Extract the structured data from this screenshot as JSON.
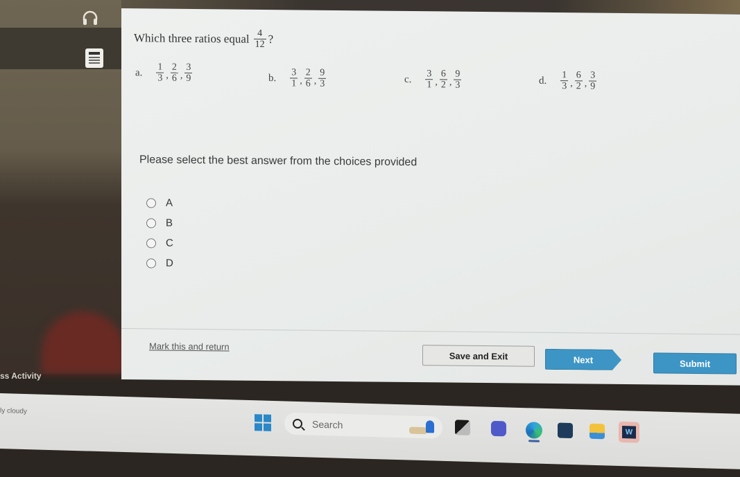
{
  "question": {
    "prompt": "Which three ratios equal",
    "fraction": {
      "num": "4",
      "den": "12"
    },
    "suffix": "?"
  },
  "choices": [
    {
      "letter": "a.",
      "fractions": [
        {
          "num": "1",
          "den": "3"
        },
        {
          "num": "2",
          "den": "6"
        },
        {
          "num": "3",
          "den": "9"
        }
      ]
    },
    {
      "letter": "b.",
      "fractions": [
        {
          "num": "3",
          "den": "1"
        },
        {
          "num": "2",
          "den": "6"
        },
        {
          "num": "9",
          "den": "3"
        }
      ]
    },
    {
      "letter": "c.",
      "fractions": [
        {
          "num": "3",
          "den": "1"
        },
        {
          "num": "6",
          "den": "2"
        },
        {
          "num": "9",
          "den": "3"
        }
      ]
    },
    {
      "letter": "d.",
      "fractions": [
        {
          "num": "1",
          "den": "3"
        },
        {
          "num": "6",
          "den": "2"
        },
        {
          "num": "3",
          "den": "9"
        }
      ]
    }
  ],
  "separator": ",",
  "instruction": "Please select the best answer from the choices provided",
  "options": [
    "A",
    "B",
    "C",
    "D"
  ],
  "footer": {
    "mark_link": "Mark this and return",
    "save_exit": "Save and Exit",
    "next": "Next",
    "submit": "Submit"
  },
  "background": {
    "activity_label": "ss Activity"
  },
  "taskbar": {
    "weather": "ly cloudy",
    "search_placeholder": "Search",
    "app_letter": "W",
    "icons": [
      "start-icon",
      "search-icon",
      "task-view-icon",
      "teams-icon",
      "edge-icon",
      "store-icon",
      "file-explorer-icon",
      "app-icon"
    ]
  },
  "tool_icons": [
    "headphones-icon",
    "calculator-icon"
  ],
  "colors": {
    "primary_button": "#3d95c6",
    "panel_bg": "#eef0ef",
    "secondary_button": "#e6e6e4"
  }
}
